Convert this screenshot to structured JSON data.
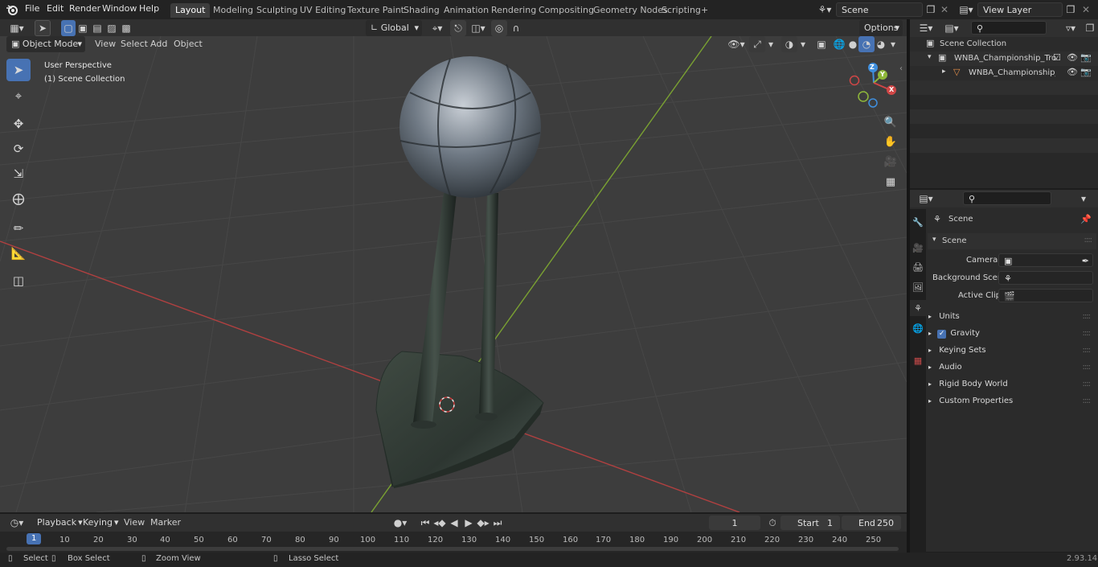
{
  "topbar": {
    "menus": [
      "File",
      "Edit",
      "Render",
      "Window",
      "Help"
    ],
    "workspaces": [
      "Layout",
      "Modeling",
      "Sculpting",
      "UV Editing",
      "Texture Paint",
      "Shading",
      "Animation",
      "Rendering",
      "Compositing",
      "Geometry Nodes",
      "Scripting"
    ],
    "active_workspace": "Layout",
    "add_tab": "+",
    "scene_name": "Scene",
    "view_layer": "View Layer"
  },
  "viewport_header": {
    "transform_orientation": "Global",
    "options_label": "Options",
    "mode": "Object Mode",
    "menus": [
      "View",
      "Select",
      "Add",
      "Object"
    ]
  },
  "viewport": {
    "perspective_label": "User Perspective",
    "collection_label": "(1) Scene Collection",
    "gizmo_axes": {
      "x": "X",
      "y": "Y",
      "z": "Z"
    }
  },
  "outliner": {
    "root": "Scene Collection",
    "items": [
      {
        "label": "WNBA_Championship_Trophy",
        "depth": 1
      },
      {
        "label": "WNBA_Championship_Tr",
        "depth": 2
      }
    ]
  },
  "properties": {
    "context_title": "Scene",
    "section_title": "Scene",
    "fields": [
      {
        "label": "Camera",
        "value": ""
      },
      {
        "label": "Background Scene",
        "value": ""
      },
      {
        "label": "Active Clip",
        "value": ""
      }
    ],
    "panels": [
      "Units",
      "Gravity",
      "Keying Sets",
      "Audio",
      "Rigid Body World",
      "Custom Properties"
    ]
  },
  "timeline": {
    "menus": [
      "Playback",
      "Keying",
      "View",
      "Marker"
    ],
    "current_frame": "1",
    "start_label": "Start",
    "start_value": "1",
    "end_label": "End",
    "end_value": "250",
    "ruler": [
      "1",
      "10",
      "20",
      "30",
      "40",
      "50",
      "60",
      "70",
      "80",
      "90",
      "100",
      "110",
      "120",
      "130",
      "140",
      "150",
      "160",
      "170",
      "180",
      "190",
      "200",
      "210",
      "220",
      "230",
      "240",
      "250"
    ]
  },
  "statusbar": {
    "items": [
      "Select",
      "Box Select",
      "Zoom View",
      "Lasso Select"
    ],
    "version": "2.93.14"
  },
  "colors": {
    "accent": "#4772b3",
    "x_axis": "#d04646",
    "y_axis": "#8fb83a",
    "z_axis": "#3f8fde"
  }
}
